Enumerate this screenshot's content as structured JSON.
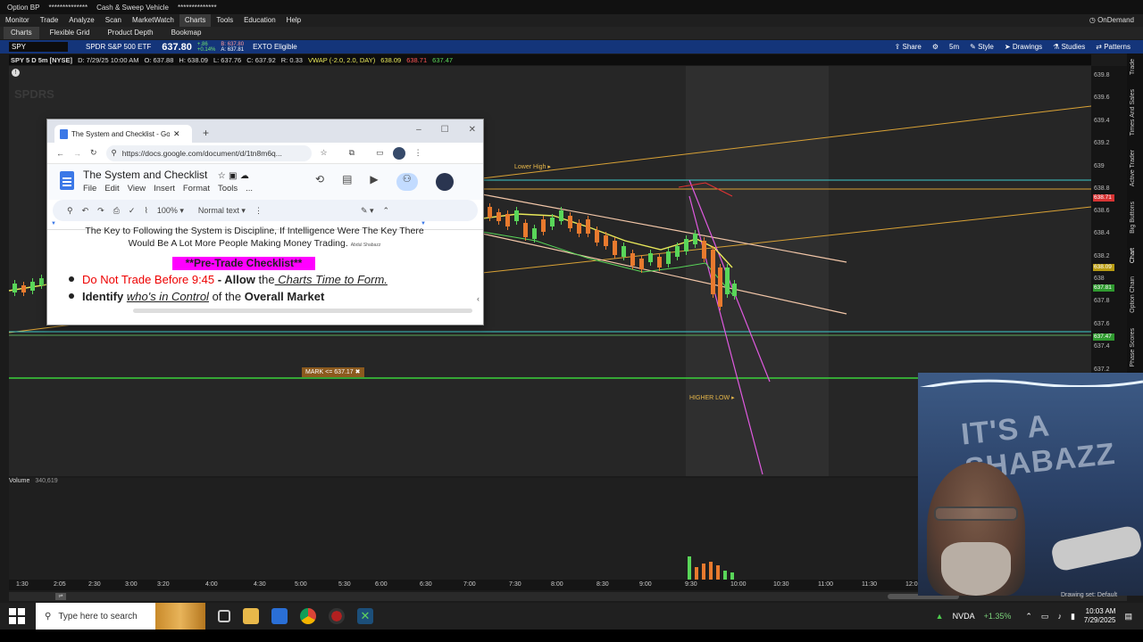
{
  "topbar": {
    "left": "Option BP",
    "mask1": "**************",
    "vehicle": "Cash & Sweep Vehicle",
    "mask2": "**************"
  },
  "menu": {
    "items": [
      "Monitor",
      "Trade",
      "Analyze",
      "Scan",
      "MarketWatch",
      "Charts",
      "Tools",
      "Education",
      "Help"
    ],
    "active": "Charts",
    "ondemand": "OnDemand"
  },
  "submenu": {
    "items": [
      "Charts",
      "Flexible Grid",
      "Product Depth",
      "Bookmap"
    ],
    "active": "Charts"
  },
  "symbol": {
    "ticker": "SPY",
    "name": "SPDR S&P 500 ETF",
    "last": "637.80",
    "change": "+.86",
    "change_pct": "+0.14%",
    "bid": "B: 637.80",
    "ask": "A: 637.81",
    "flag": "EXTO Eligible"
  },
  "chart_tools": {
    "share": "Share",
    "interval": "5m",
    "style": "Style",
    "drawings": "Drawings",
    "studies": "Studies",
    "patterns": "Patterns"
  },
  "infobar": {
    "label": "SPY 5 D 5m [NYSE]",
    "date": "D: 7/29/25 10:00 AM",
    "open": "O: 637.88",
    "high": "H: 638.09",
    "low": "L: 637.76",
    "close": "C: 637.92",
    "range": "R: 0.33",
    "vwap": "VWAP (-2.0, 2.0, DAY)",
    "vwap_v1": "638.09",
    "vwap_v2": "638.71",
    "vwap_v3": "637.47"
  },
  "price_axis": [
    "639.8",
    "639.6",
    "639.4",
    "639.2",
    "639",
    "638.8",
    "638.6",
    "638.4",
    "638.2",
    "638",
    "637.8",
    "637.6",
    "637.4",
    "637.2"
  ],
  "price_tags": {
    "t1": "638.71",
    "t2": "638.09",
    "t3": "637.81",
    "t4": "637.47"
  },
  "annotations": {
    "lower_high": "Lower High",
    "higher_low": "HIGHER LOW",
    "mark": "MARK <= 637.17"
  },
  "watermark": "SPDRS",
  "volume": {
    "label": "Volume",
    "value": "340,619"
  },
  "time_axis": [
    "1:30",
    "2:05",
    "2:30",
    "3:00",
    "3:20",
    "4:00",
    "4:30",
    "5:00",
    "5:30",
    "6:00",
    "6:30",
    "7:00",
    "7:30",
    "8:00",
    "8:30",
    "9:00",
    "9:30",
    "10:00",
    "10:30",
    "11:00",
    "11:30",
    "12:0"
  ],
  "right_tabs": [
    "Trade",
    "Times And Sales",
    "Active Trader",
    "Big Buttons",
    "Chart",
    "Option Chain",
    "Phase Scores"
  ],
  "gdoc": {
    "tab_title": "The System and Checklist - Goo",
    "url": "https://docs.google.com/document/d/1tn8m6q...",
    "title": "The System and Checklist",
    "menu": [
      "File",
      "Edit",
      "View",
      "Insert",
      "Format",
      "Tools",
      "..."
    ],
    "zoom": "100%",
    "style": "Normal text",
    "quote_line1": "The Key to Following the System is Discipline, If Intelligence Were The Key There",
    "quote_line2": "Would Be A Lot More People Making Money Trading.",
    "quote_author": "Abdul Shabazz",
    "checklist_header": "**Pre-Trade Checklist**",
    "b1_red": "Do Not Trade Before 9:45",
    "b1_dash": " - ",
    "b1_bold": "Allow",
    "b1_mid": " the",
    "b1_ital": " Charts Time to Form.",
    "b2_bold": "Identify",
    "b2_ital": "who's in Control",
    "b2_mid": " of the ",
    "b2_end": "Overall Market"
  },
  "webcam": {
    "banner": "IT'S A SHABAZZ"
  },
  "taskbar": {
    "search_placeholder": "Type here to search",
    "ticker": "NVDA",
    "ticker_change": "+1.35%",
    "time": "10:03 AM",
    "date": "7/29/2025",
    "drawing_set": "Drawing set: Default"
  }
}
